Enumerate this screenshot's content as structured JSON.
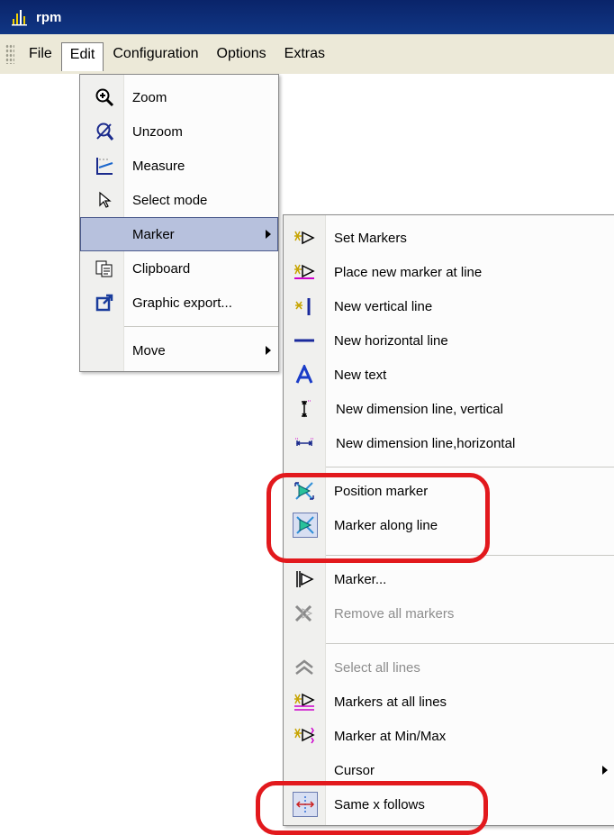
{
  "window": {
    "title": "rpm"
  },
  "menubar": {
    "items": [
      "File",
      "Edit",
      "Configuration",
      "Options",
      "Extras"
    ]
  },
  "edit_menu": {
    "items": [
      {
        "label": "Zoom",
        "icon": "zoom-in-icon"
      },
      {
        "label": "Unzoom",
        "icon": "unzoom-icon"
      },
      {
        "label": "Measure",
        "icon": "measure-icon"
      },
      {
        "label": "Select mode",
        "icon": "cursor-arrow-icon"
      },
      {
        "label": "Marker",
        "icon": "",
        "submenu": true
      },
      {
        "label": "Clipboard",
        "icon": "clipboard-icon"
      },
      {
        "label": "Graphic export...",
        "icon": "export-icon"
      },
      {
        "label": "Move",
        "icon": "",
        "submenu": true
      }
    ]
  },
  "marker_menu": {
    "items": [
      {
        "label": "Set Markers",
        "icon": "set-markers-icon"
      },
      {
        "label": "Place new marker at line",
        "icon": "place-marker-icon"
      },
      {
        "label": "New vertical line",
        "icon": "vertical-line-icon"
      },
      {
        "label": "New horizontal line",
        "icon": "horizontal-line-icon"
      },
      {
        "label": "New text",
        "icon": "text-icon"
      },
      {
        "label": "New dimension line, vertical",
        "icon": "dimension-vertical-icon"
      },
      {
        "label": "New dimension line,horizontal",
        "icon": "dimension-horizontal-icon"
      },
      {
        "label": "Position marker",
        "icon": "position-marker-icon"
      },
      {
        "label": "Marker along line",
        "icon": "marker-along-line-icon"
      },
      {
        "label": "Marker...",
        "icon": "marker-dialog-icon"
      },
      {
        "label": "Remove all markers",
        "icon": "remove-markers-icon",
        "disabled": true
      },
      {
        "label": "Select all lines",
        "icon": "select-lines-icon",
        "disabled": true
      },
      {
        "label": "Markers at all lines",
        "icon": "markers-all-lines-icon"
      },
      {
        "label": "Marker at Min/Max",
        "icon": "marker-minmax-icon"
      },
      {
        "label": "Cursor",
        "icon": "",
        "submenu": true
      },
      {
        "label": "Same x follows",
        "icon": "same-x-follows-icon"
      }
    ]
  },
  "colors": {
    "highlight": "#b7c1dd",
    "annotation_ring": "#e2191d",
    "titlebar": "#0a246a"
  }
}
